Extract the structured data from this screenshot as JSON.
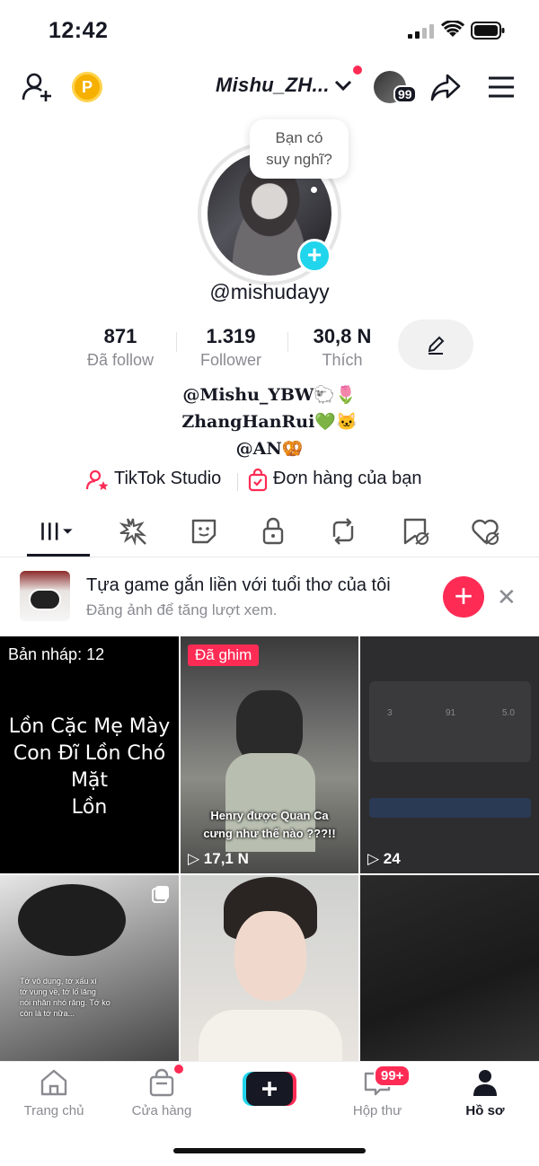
{
  "status": {
    "time": "12:42"
  },
  "header": {
    "username": "Mishu_ZH...",
    "notif_count": "99"
  },
  "profile": {
    "thought_bubble": [
      "Bạn có",
      "suy nghĩ?"
    ],
    "handle": "@mishudayy",
    "stats": [
      {
        "value": "871",
        "label": "Đã follow"
      },
      {
        "value": "1.319",
        "label": "Follower"
      },
      {
        "value": "30,8 N",
        "label": "Thích"
      }
    ],
    "bio_lines": [
      "@Mishu_YBW🐑🌷",
      "ZhangHanRui💚🐱",
      "@AN🥨"
    ]
  },
  "links": {
    "studio": "TikTok Studio",
    "orders": "Đơn hàng của bạn"
  },
  "promo": {
    "title": "Tựa game gắn liền với tuổi thơ của tôi",
    "subtitle": "Đăng ảnh để tăng lượt xem."
  },
  "grid": {
    "drafts_label": "Bản nháp: 12",
    "draft_text": [
      "Lồn Cặc Mẹ Mày",
      "Con Đĩ Lồn Chó Mặt",
      "Lồn"
    ],
    "pinned_label": "Đã ghim",
    "pinned_caption": [
      "Henry được Quan Ca",
      "cưng như thế nào ???!!"
    ],
    "pinned_views": "17,1 N",
    "third_views": "24",
    "third_stats": [
      "3",
      "91",
      "5.0"
    ],
    "fourth_caption": [
      "Tớ vô dụng, tớ xấu xí",
      "tớ vụng về, tớ lố lăng",
      "nói nhăn nhó răng. Tớ ko",
      "còn là tớ nữa..."
    ]
  },
  "nav": {
    "home": "Trang chủ",
    "shop": "Cửa hàng",
    "inbox": "Hộp thư",
    "inbox_badge": "99+",
    "profile": "Hồ sơ"
  },
  "colors": {
    "accent": "#fe2c55",
    "cyan": "#20d5ec",
    "text": "#161823",
    "muted": "#8a8b91"
  }
}
